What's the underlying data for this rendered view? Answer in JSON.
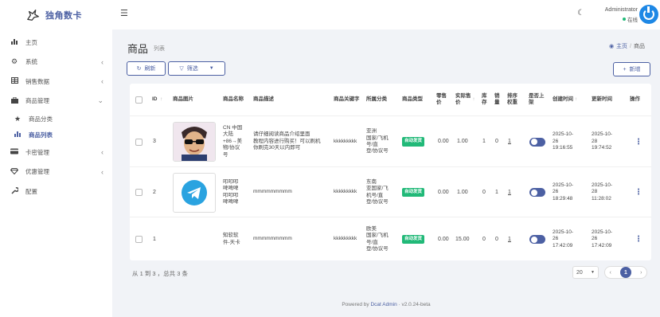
{
  "brand": {
    "name": "独角数卡"
  },
  "sidebar": {
    "items": [
      {
        "label": "主页",
        "icon": "bar-chart-icon"
      },
      {
        "label": "系统",
        "icon": "gear-icon"
      },
      {
        "label": "销售数据",
        "icon": "table-icon"
      },
      {
        "label": "商品管理",
        "icon": "briefcase-icon"
      },
      {
        "label": "卡密管理",
        "icon": "credit-card-icon"
      },
      {
        "label": "优惠管理",
        "icon": "diamond-icon"
      },
      {
        "label": "配置",
        "icon": "wrench-icon"
      }
    ],
    "submenu": [
      {
        "label": "商品分类",
        "icon": "star-icon"
      },
      {
        "label": "商品列表",
        "icon": "bar-chart-icon"
      }
    ]
  },
  "topbar": {
    "admin_name": "Administrator",
    "admin_status": "在线"
  },
  "header": {
    "title": "商品",
    "subtitle": "列表",
    "breadcrumb_home": "主页",
    "breadcrumb_current": "商品"
  },
  "toolbar": {
    "refresh": "刷新",
    "filter": "筛选",
    "new": "新增"
  },
  "table": {
    "headers": {
      "id": "ID",
      "image": "商品图片",
      "name": "商品名称",
      "desc": "商品描述",
      "keyword": "商品关键字",
      "category": "所属分类",
      "type": "商品类型",
      "price": "零售\n价",
      "actual": "实际售\n价",
      "stock": "库\n存",
      "sales": "销\n量",
      "sort": "排序\n权重",
      "online": "是否上\n架",
      "created": "创建时间",
      "updated": "更新时间",
      "actions": "操作"
    },
    "rows": [
      {
        "id": "3",
        "name": "CN 中国\n大陆\n+86→美\n物/协议\n号",
        "desc": "请仔细阅读商品介绍里面\n教程内容进行购买！可以刷机\n你刷完30天以内即可",
        "keyword": "kkkkkkkkk",
        "category": "亚洲\n国家/飞机\n号/直\n登/协议号",
        "type": "自动发货",
        "price": "0.00",
        "actual": "1.00",
        "stock": "1",
        "sales": "0",
        "sort": "1",
        "created": "2025-10-\n26\n19:16:55",
        "updated": "2025-10-\n28\n19:74:52"
      },
      {
        "id": "2",
        "name": "叩叩叩\n啤啤啤\n叩叩叩\n啤啤啤",
        "desc": "mmmmmmmmm",
        "keyword": "kkkkkkkkk",
        "category": "东南\n亚国家/飞\n机号/直\n登/协议号",
        "type": "自动发货",
        "price": "0.00",
        "actual": "1.00",
        "stock": "0",
        "sales": "1",
        "sort": "1",
        "created": "2025-10-\n26\n18:29:48",
        "updated": "2025-10-\n28\n11:28:02"
      },
      {
        "id": "1",
        "name": "知软软\n件-天卡",
        "desc": "mmmmmmmmm",
        "keyword": "kkkkkkkkk",
        "category": "欧美\n国家/飞机\n号/直\n登/协议号",
        "type": "自动发货",
        "price": "0.00",
        "actual": "15.00",
        "stock": "0",
        "sales": "0",
        "sort": "1",
        "created": "2025-10-\n26\n17:42:09",
        "updated": "2025-10-\n26\n17:42:09"
      }
    ]
  },
  "pagination": {
    "info": "从 1 到 3 ，总共 3 条",
    "per_page": "20",
    "current": "1"
  },
  "footer": {
    "prefix": "Powered by ",
    "link": "Dcat Admin",
    "version": " · v2.0.24-beta"
  },
  "colors": {
    "accent": "#4c60a3",
    "success": "#21b978"
  }
}
